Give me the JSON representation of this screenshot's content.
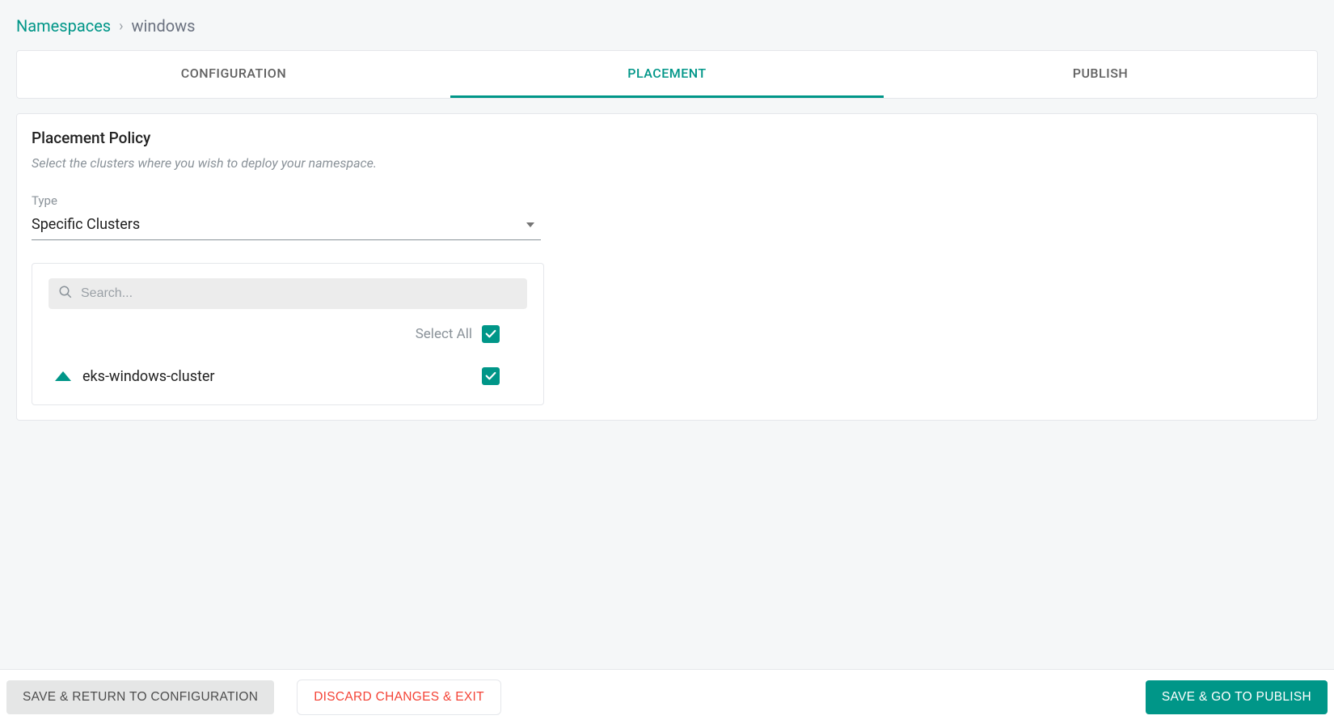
{
  "breadcrumb": {
    "root": "Namespaces",
    "separator": "›",
    "leaf": "windows"
  },
  "tabs": {
    "configuration": "CONFIGURATION",
    "placement": "PLACEMENT",
    "publish": "PUBLISH",
    "active": "placement"
  },
  "panel": {
    "title": "Placement Policy",
    "description": "Select the clusters where you wish to deploy your namespace."
  },
  "typeField": {
    "label": "Type",
    "value": "Specific Clusters"
  },
  "clusterPicker": {
    "searchPlaceholder": "Search...",
    "selectAllLabel": "Select All",
    "selectAllChecked": true,
    "items": [
      {
        "name": "eks-windows-cluster",
        "checked": true
      }
    ]
  },
  "footer": {
    "back": "SAVE & RETURN TO CONFIGURATION",
    "discard": "DISCARD CHANGES & EXIT",
    "forward": "SAVE & GO TO PUBLISH"
  },
  "colors": {
    "accent": "#009688",
    "danger": "#f44336",
    "muted": "#8a9299"
  }
}
